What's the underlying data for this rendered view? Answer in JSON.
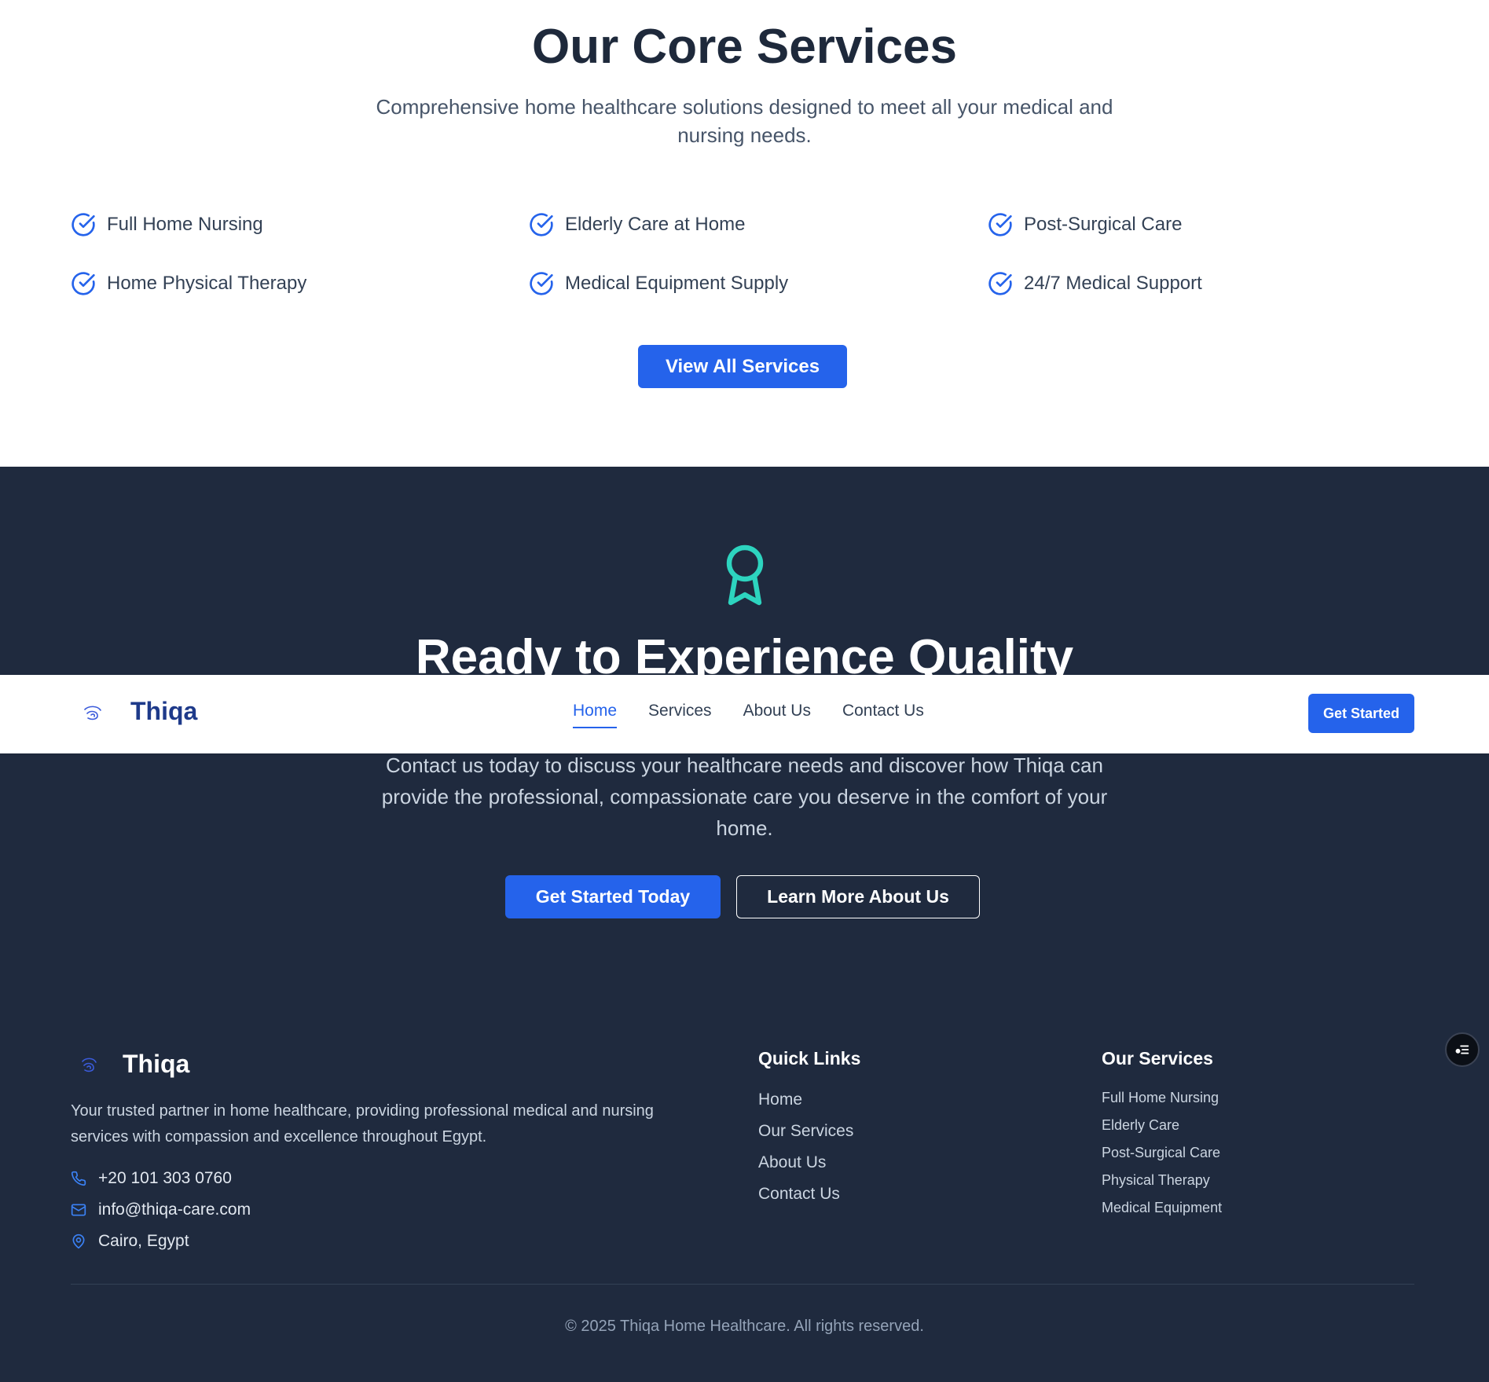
{
  "services": {
    "title": "Our Core Services",
    "subtitle": "Comprehensive home healthcare solutions designed to meet all your medical and nursing needs.",
    "items": [
      {
        "label": "Full Home Nursing",
        "icon": "check-circle-icon"
      },
      {
        "label": "Elderly Care at Home",
        "icon": "check-circle-icon"
      },
      {
        "label": "Post-Surgical Care",
        "icon": "check-circle-icon"
      },
      {
        "label": "Home Physical Therapy",
        "icon": "check-circle-icon"
      },
      {
        "label": "Medical Equipment Supply",
        "icon": "check-circle-icon"
      },
      {
        "label": "24/7 Medical Support",
        "icon": "check-circle-icon"
      }
    ],
    "view_all_label": "View All Services"
  },
  "cta": {
    "icon": "award-icon",
    "title": "Ready to Experience Quality",
    "text": "Contact us today to discuss your healthcare needs and discover how Thiqa can provide the professional, compassionate care you deserve in the comfort of your home.",
    "primary_label": "Get Started Today",
    "secondary_label": "Learn More About Us"
  },
  "header": {
    "brand": "Thiqa",
    "logo_icon": "heart-hand-logo-icon",
    "nav": [
      {
        "label": "Home",
        "active": true
      },
      {
        "label": "Services",
        "active": false
      },
      {
        "label": "About Us",
        "active": false
      },
      {
        "label": "Contact Us",
        "active": false
      }
    ],
    "cta_label": "Get Started"
  },
  "footer": {
    "brand": "Thiqa",
    "description": "Your trusted partner in home healthcare, providing professional medical and nursing services with compassion and excellence throughout Egypt.",
    "contact": {
      "phone": "+20 101 303 0760",
      "email": "info@thiqa-care.com",
      "location": "Cairo, Egypt"
    },
    "quick_links_title": "Quick Links",
    "quick_links": [
      "Home",
      "Our Services",
      "About Us",
      "Contact Us"
    ],
    "services_title": "Our Services",
    "services_links": [
      "Full Home Nursing",
      "Elderly Care",
      "Post-Surgical Care",
      "Physical Therapy",
      "Medical Equipment"
    ],
    "copyright": "© 2025 Thiqa Home Healthcare. All rights reserved."
  },
  "colors": {
    "primary": "#2563eb",
    "dark_bg": "#1f2a3e",
    "heading": "#1e293b",
    "brand_text": "#1e3a8a",
    "award_accent": "#2dd4bf"
  },
  "floating_button_icon": "accessibility-menu-icon"
}
